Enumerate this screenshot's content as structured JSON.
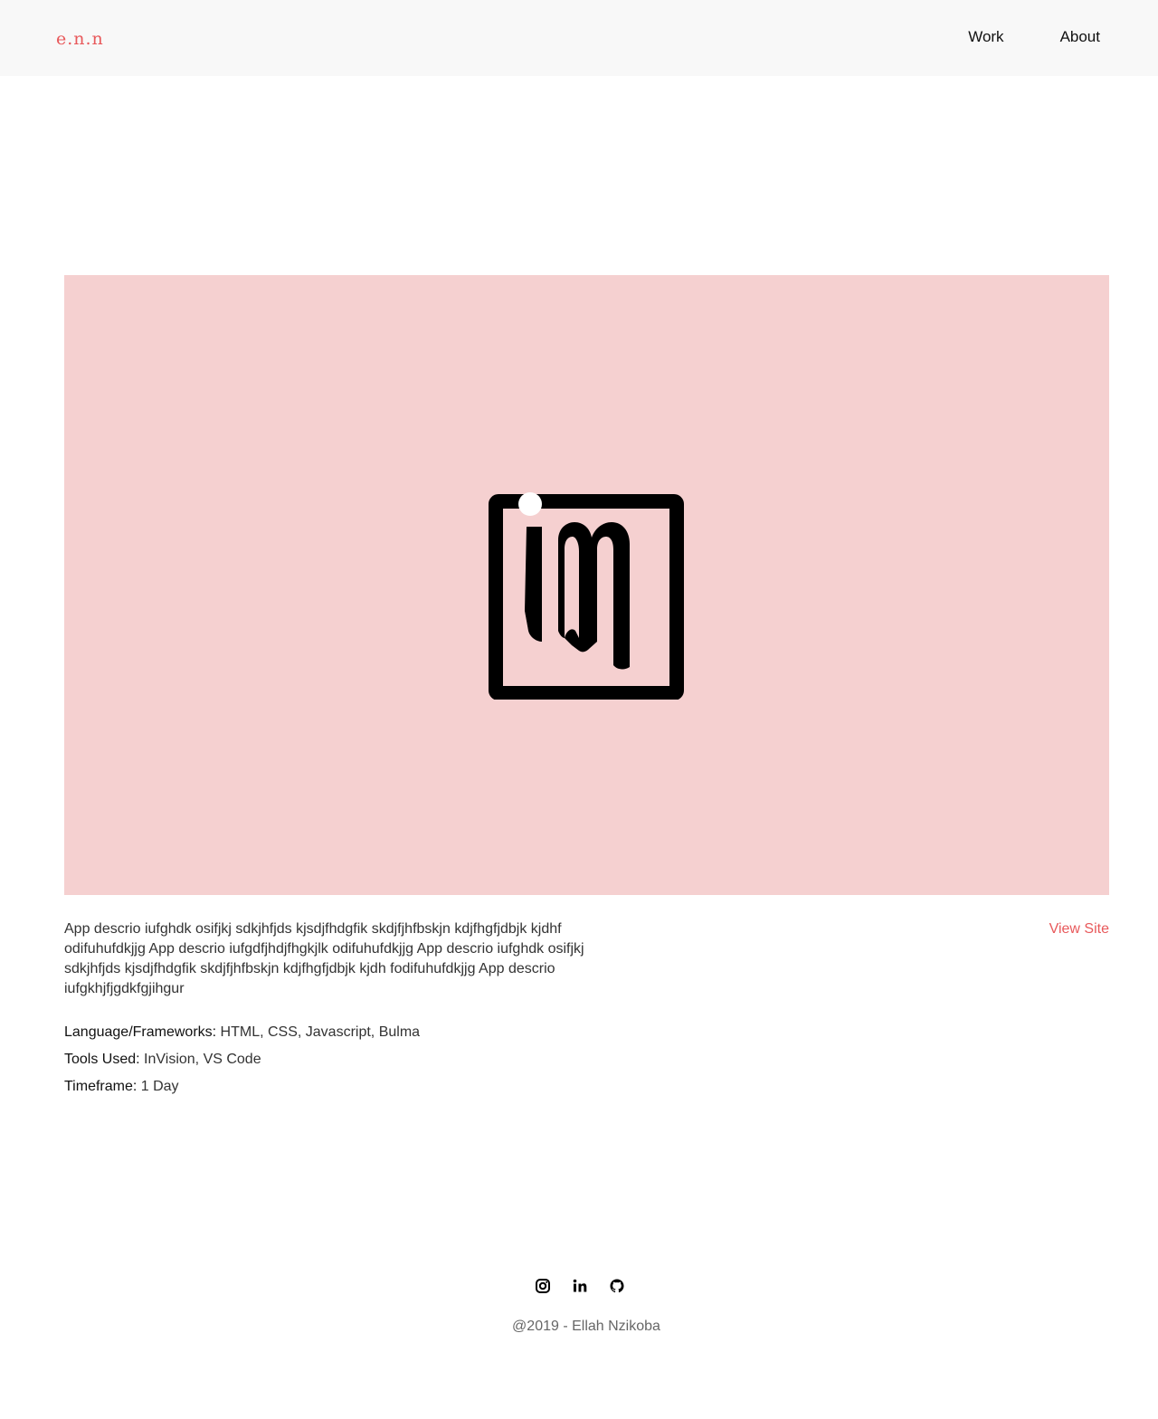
{
  "header": {
    "logo_text": "e.n.n",
    "nav": [
      {
        "label": "Work"
      },
      {
        "label": "About"
      }
    ]
  },
  "hero": {
    "background_color": "#f5d0d0",
    "logo_icon": "im-square-logo"
  },
  "project": {
    "description": "App descrio iufghdk osifjkj sdkjhfjds kjsdjfhdgfik skdjfjhfbskjn kdjfhgfjdbjk kjdhf odifuhufdkjjg App descrio iufgdfjhdjfhgkjlk odifuhufdkjjg App descrio iufghdk osifjkj sdkjhfjds kjsdjfhdgfik skdjfjhfbskjn kdjfhgfjdbjk kjdh fodifuhufdkjjg App descrio iufgkhjfjgdkfgjihgur",
    "view_site_label": "View Site",
    "meta": [
      {
        "label": "Language/Frameworks:",
        "value": " HTML, CSS, Javascript, Bulma"
      },
      {
        "label": "Tools Used:",
        "value": " InVision, VS Code"
      },
      {
        "label": "Timeframe:",
        "value": " 1 Day"
      }
    ]
  },
  "footer": {
    "social_icons": [
      "instagram-icon",
      "linkedin-icon",
      "github-icon"
    ],
    "copyright": "@2019 - Ellah Nzikoba"
  },
  "colors": {
    "accent": "#e8595b",
    "navbar_bg": "#f8f8f8"
  }
}
